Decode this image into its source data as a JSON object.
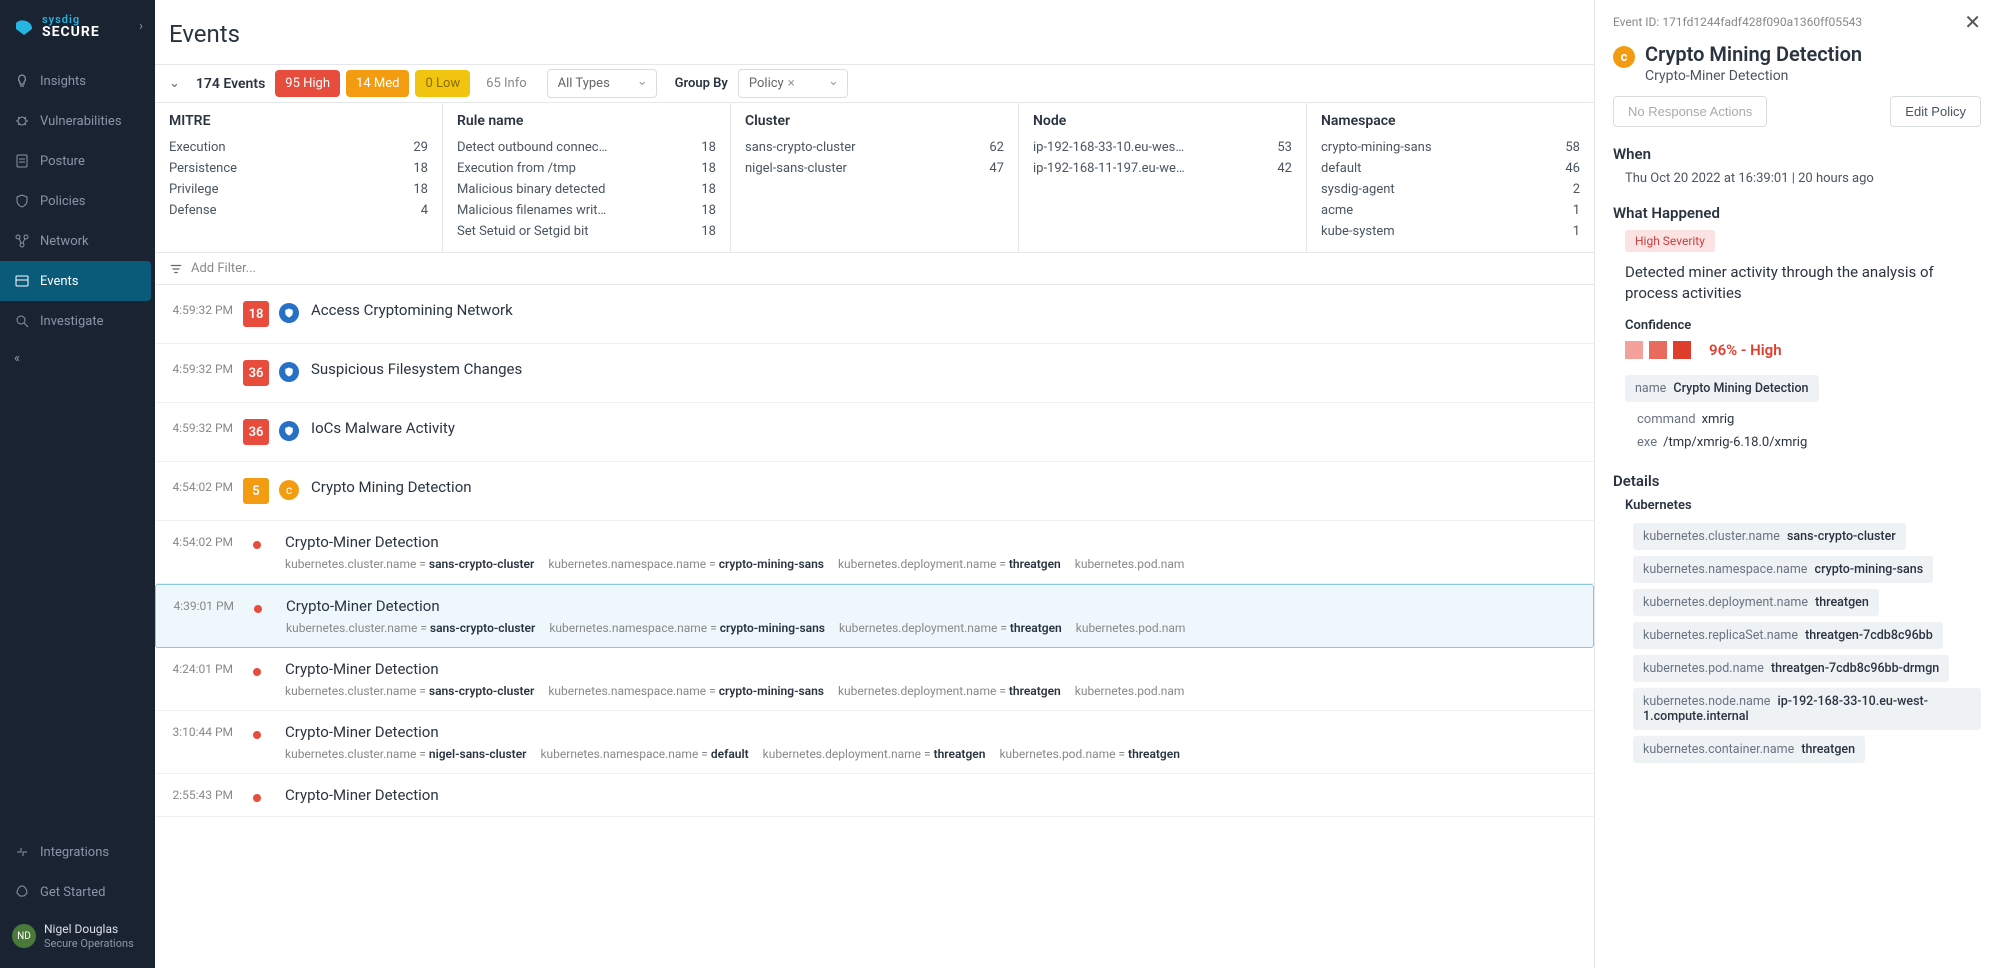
{
  "brand": {
    "top": "sysdig",
    "bottom": "SECURE"
  },
  "nav": {
    "insights": "Insights",
    "vulnerabilities": "Vulnerabilities",
    "posture": "Posture",
    "policies": "Policies",
    "network": "Network",
    "events": "Events",
    "investigate": "Investigate",
    "integrations": "Integrations",
    "get_started": "Get Started"
  },
  "user": {
    "initials": "ND",
    "name": "Nigel Douglas",
    "org": "Secure Operations"
  },
  "page": {
    "title": "Events"
  },
  "toolbar": {
    "count": "174 Events",
    "high": "95 High",
    "med": "14 Med",
    "low": "0 Low",
    "info": "65 Info",
    "types": "All Types",
    "groupby_label": "Group By",
    "groupby_value": "Policy"
  },
  "summary": {
    "mitre": {
      "title": "MITRE",
      "rows": [
        {
          "l": "Execution",
          "v": "29"
        },
        {
          "l": "Persistence",
          "v": "18"
        },
        {
          "l": "Privilege",
          "v": "18"
        },
        {
          "l": "Defense",
          "v": "4"
        }
      ]
    },
    "rule": {
      "title": "Rule name",
      "rows": [
        {
          "l": "Detect outbound connec…",
          "v": "18"
        },
        {
          "l": "Execution from /tmp",
          "v": "18"
        },
        {
          "l": "Malicious binary detected",
          "v": "18"
        },
        {
          "l": "Malicious filenames writ…",
          "v": "18"
        },
        {
          "l": "Set Setuid or Setgid bit",
          "v": "18"
        }
      ]
    },
    "cluster": {
      "title": "Cluster",
      "rows": [
        {
          "l": "sans-crypto-cluster",
          "v": "62"
        },
        {
          "l": "nigel-sans-cluster",
          "v": "47"
        }
      ]
    },
    "node": {
      "title": "Node",
      "rows": [
        {
          "l": "ip-192-168-33-10.eu-wes…",
          "v": "53"
        },
        {
          "l": "ip-192-168-11-197.eu-we…",
          "v": "42"
        }
      ]
    },
    "namespace": {
      "title": "Namespace",
      "rows": [
        {
          "l": "crypto-mining-sans",
          "v": "58"
        },
        {
          "l": "default",
          "v": "46"
        },
        {
          "l": "sysdig-agent",
          "v": "2"
        },
        {
          "l": "acme",
          "v": "1"
        },
        {
          "l": "kube-system",
          "v": "1"
        }
      ]
    }
  },
  "filter": {
    "placeholder": "Add Filter..."
  },
  "events": [
    {
      "time": "4:59:32 PM",
      "badge": "18",
      "badgeColor": "red",
      "icon": "shield",
      "title": "Access Cryptomining Network"
    },
    {
      "time": "4:59:32 PM",
      "badge": "36",
      "badgeColor": "red",
      "icon": "shield",
      "title": "Suspicious Filesystem Changes"
    },
    {
      "time": "4:59:32 PM",
      "badge": "36",
      "badgeColor": "red",
      "icon": "shield",
      "title": "IoCs Malware Activity"
    },
    {
      "time": "4:54:02 PM",
      "badge": "5",
      "badgeColor": "orange",
      "icon": "crypto",
      "title": "Crypto Mining Detection"
    }
  ],
  "subevents": [
    {
      "time": "4:54:02 PM",
      "title": "Crypto-Miner Detection",
      "highlighted": false,
      "meta": [
        {
          "k": "kubernetes.cluster.name",
          "v": "sans-crypto-cluster"
        },
        {
          "k": "kubernetes.namespace.name",
          "v": "crypto-mining-sans"
        },
        {
          "k": "kubernetes.deployment.name",
          "v": "threatgen"
        },
        {
          "k": "kubernetes.pod.nam",
          "v": ""
        }
      ]
    },
    {
      "time": "4:39:01 PM",
      "title": "Crypto-Miner Detection",
      "highlighted": true,
      "meta": [
        {
          "k": "kubernetes.cluster.name",
          "v": "sans-crypto-cluster"
        },
        {
          "k": "kubernetes.namespace.name",
          "v": "crypto-mining-sans"
        },
        {
          "k": "kubernetes.deployment.name",
          "v": "threatgen"
        },
        {
          "k": "kubernetes.pod.nam",
          "v": ""
        }
      ]
    },
    {
      "time": "4:24:01 PM",
      "title": "Crypto-Miner Detection",
      "highlighted": false,
      "meta": [
        {
          "k": "kubernetes.cluster.name",
          "v": "sans-crypto-cluster"
        },
        {
          "k": "kubernetes.namespace.name",
          "v": "crypto-mining-sans"
        },
        {
          "k": "kubernetes.deployment.name",
          "v": "threatgen"
        },
        {
          "k": "kubernetes.pod.nam",
          "v": ""
        }
      ]
    },
    {
      "time": "3:10:44 PM",
      "title": "Crypto-Miner Detection",
      "highlighted": false,
      "meta": [
        {
          "k": "kubernetes.cluster.name",
          "v": "nigel-sans-cluster"
        },
        {
          "k": "kubernetes.namespace.name",
          "v": "default"
        },
        {
          "k": "kubernetes.deployment.name",
          "v": "threatgen"
        },
        {
          "k": "kubernetes.pod.name",
          "v": "threatgen"
        }
      ]
    },
    {
      "time": "2:55:43 PM",
      "title": "Crypto-Miner Detection",
      "highlighted": false,
      "meta": []
    }
  ],
  "detail": {
    "event_id_label": "Event ID: 171fd1244fadf428f090a1360ff05543",
    "title": "Crypto Mining Detection",
    "subtitle": "Crypto-Miner Detection",
    "no_response": "No Response Actions",
    "edit_policy": "Edit Policy",
    "when_title": "When",
    "when_text": "Thu Oct 20 2022 at 16:39:01 | 20 hours ago",
    "what_title": "What Happened",
    "severity": "High Severity",
    "what_text": "Detected miner activity through the analysis of process activities",
    "confidence_label": "Confidence",
    "confidence_text": "96% - High",
    "name_pill_k": "name",
    "name_pill_v": "Crypto Mining Detection",
    "command_k": "command",
    "command_v": "xmrig",
    "exe_k": "exe",
    "exe_v": "/tmp/xmrig-6.18.0/xmrig",
    "details_title": "Details",
    "kubernetes_title": "Kubernetes",
    "k8s": [
      {
        "k": "kubernetes.cluster.name",
        "v": "sans-crypto-cluster"
      },
      {
        "k": "kubernetes.namespace.name",
        "v": "crypto-mining-sans"
      },
      {
        "k": "kubernetes.deployment.name",
        "v": "threatgen"
      },
      {
        "k": "kubernetes.replicaSet.name",
        "v": "threatgen-7cdb8c96bb"
      },
      {
        "k": "kubernetes.pod.name",
        "v": "threatgen-7cdb8c96bb-drmgn"
      },
      {
        "k": "kubernetes.node.name",
        "v": "ip-192-168-33-10.eu-west-1.compute.internal"
      },
      {
        "k": "kubernetes.container.name",
        "v": "threatgen"
      }
    ]
  }
}
